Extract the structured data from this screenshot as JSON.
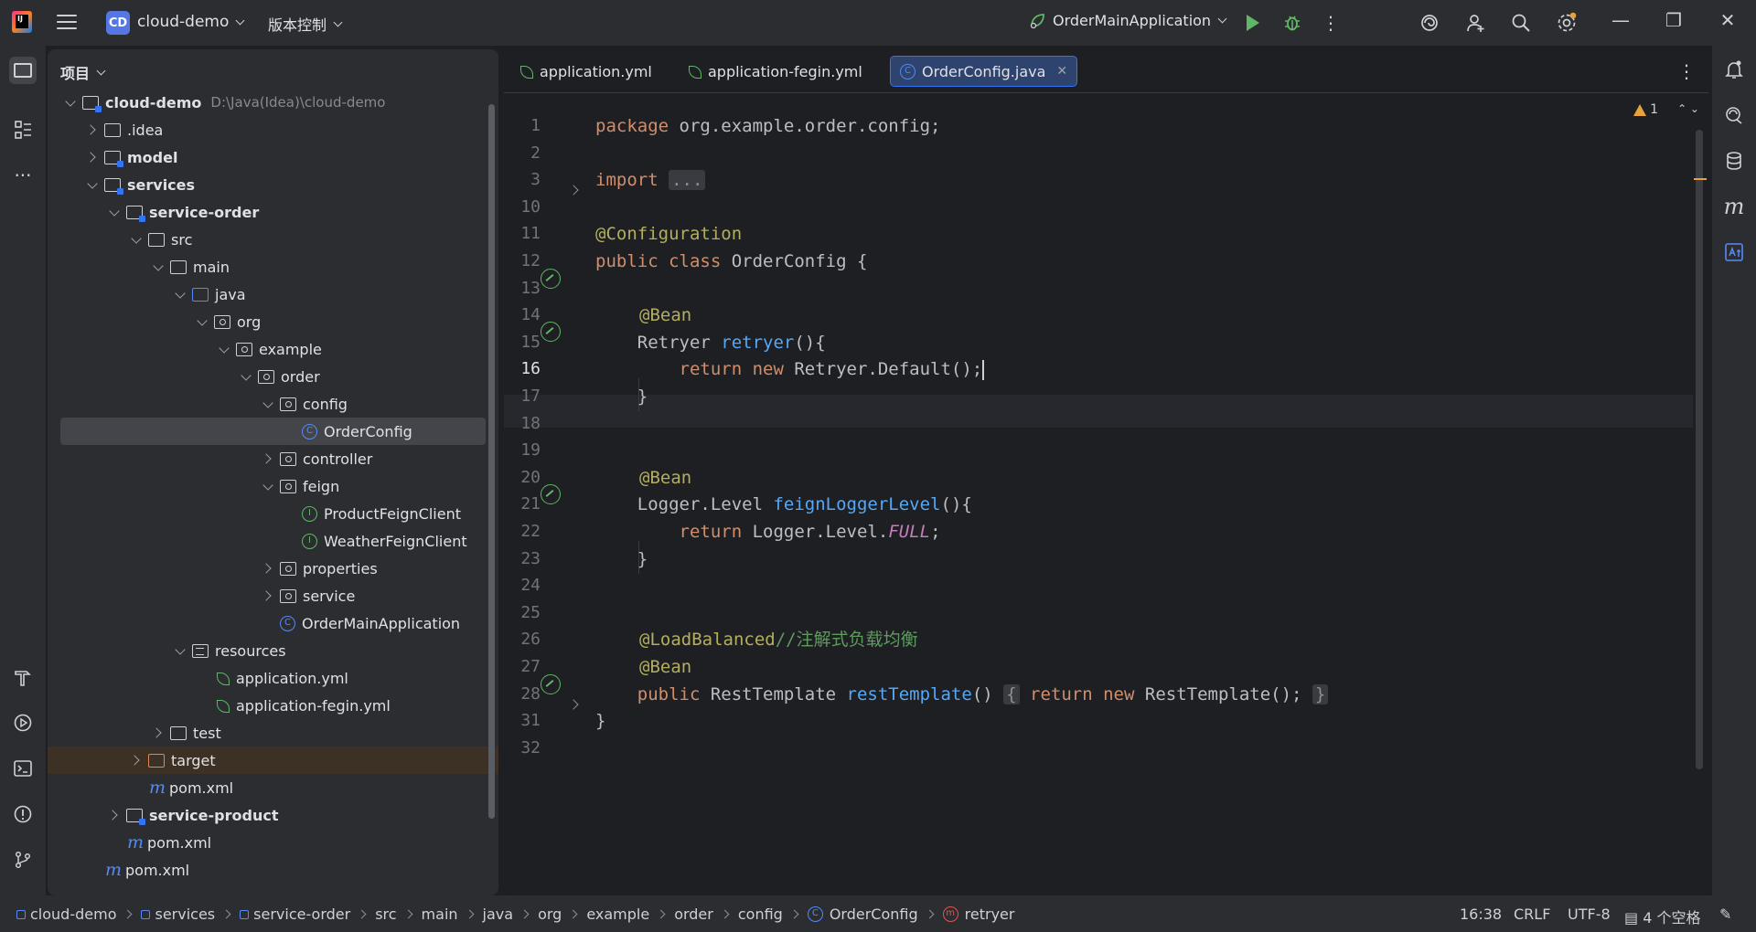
{
  "titlebar": {
    "project_badge": "CD",
    "project_name": "cloud-demo",
    "vcs_label": "版本控制",
    "run_config": "OrderMainApplication"
  },
  "project_panel": {
    "title": "项目",
    "tree": [
      {
        "label": "cloud-demo",
        "extra": "D:\\Java(Idea)\\cloud-demo"
      },
      {
        "label": ".idea"
      },
      {
        "label": "model"
      },
      {
        "label": "services"
      },
      {
        "label": "service-order"
      },
      {
        "label": "src"
      },
      {
        "label": "main"
      },
      {
        "label": "java"
      },
      {
        "label": "org"
      },
      {
        "label": "example"
      },
      {
        "label": "order"
      },
      {
        "label": "config"
      },
      {
        "label": "OrderConfig"
      },
      {
        "label": "controller"
      },
      {
        "label": "feign"
      },
      {
        "label": "ProductFeignClient"
      },
      {
        "label": "WeatherFeignClient"
      },
      {
        "label": "properties"
      },
      {
        "label": "service"
      },
      {
        "label": "OrderMainApplication"
      },
      {
        "label": "resources"
      },
      {
        "label": "application.yml"
      },
      {
        "label": "application-fegin.yml"
      },
      {
        "label": "test"
      },
      {
        "label": "target"
      },
      {
        "label": "pom.xml"
      },
      {
        "label": "service-product"
      },
      {
        "label": "pom.xml"
      },
      {
        "label": "pom.xml"
      }
    ]
  },
  "editor": {
    "tabs": [
      "application.yml",
      "application-fegin.yml",
      "OrderConfig.java"
    ],
    "warning_count": "1",
    "line_numbers": [
      "1",
      "2",
      "3",
      "10",
      "11",
      "12",
      "13",
      "14",
      "15",
      "16",
      "17",
      "18",
      "19",
      "20",
      "21",
      "22",
      "23",
      "24",
      "25",
      "26",
      "27",
      "28",
      "31",
      "32"
    ],
    "code": {
      "l1_kw": "package",
      "l1_rest": " org.example.order.config;",
      "l3_kw": "import",
      "l3_fold": "...",
      "l11_ann": "@Configuration",
      "l12_kw": "public class",
      "l12_rest": " OrderConfig {",
      "l14_ann": "@Bean",
      "l15_type": "    Retryer ",
      "l15_fn": "retryer",
      "l15_rest": "(){",
      "l16_kw": "        return new",
      "l16_rest": " Retryer.Default();",
      "l17": "    }",
      "l20_ann": "@Bean",
      "l21_type": "    Logger.Level ",
      "l21_fn": "feignLoggerLevel",
      "l21_rest": "(){",
      "l22_kw": "        return",
      "l22_mid": " Logger.Level.",
      "l22_const": "FULL",
      "l22_end": ";",
      "l23": "    }",
      "l26_ann": "@LoadBalanced",
      "l26_cmt": "//注解式负载均衡",
      "l27_ann": "@Bean",
      "l28_kw": "    public",
      "l28_type": " RestTemplate ",
      "l28_fn": "restTemplate",
      "l28_paren": "() ",
      "l28_f1": "{",
      "l28_kw2": " return new",
      "l28_rest": " RestTemplate(); ",
      "l28_f2": "}",
      "l31": "}"
    }
  },
  "statusbar": {
    "breadcrumbs": [
      "cloud-demo",
      "services",
      "service-order",
      "src",
      "main",
      "java",
      "org",
      "example",
      "order",
      "config",
      "OrderConfig",
      "retryer"
    ],
    "position": "16:38",
    "line_sep": "CRLF",
    "encoding": "UTF-8",
    "indent": "4 个空格"
  }
}
